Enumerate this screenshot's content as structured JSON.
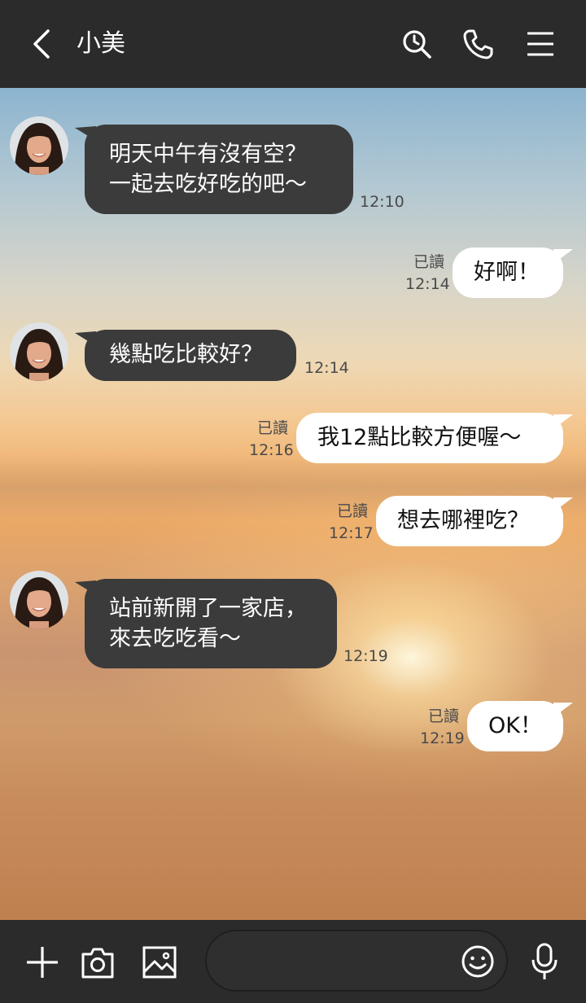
{
  "header": {
    "title": "小美",
    "back_icon": "chevron-left-icon",
    "search_icon": "search-icon",
    "call_icon": "phone-icon",
    "menu_icon": "menu-icon"
  },
  "messages": [
    {
      "side": "in",
      "text": "明天中午有沒有空？\n一起去吃好吃的吧～",
      "time": "12:10"
    },
    {
      "side": "out",
      "text": "好啊！",
      "read": "已讀",
      "time": "12:14"
    },
    {
      "side": "in",
      "text": "幾點吃比較好？",
      "time": "12:14"
    },
    {
      "side": "out",
      "text": "我12點比較方便喔～",
      "read": "已讀",
      "time": "12:16"
    },
    {
      "side": "out",
      "text": "想去哪裡吃？",
      "read": "已讀",
      "time": "12:17"
    },
    {
      "side": "in",
      "text": "站前新開了一家店，\n來去吃吃看～",
      "time": "12:19"
    },
    {
      "side": "out",
      "text": "OK！",
      "read": "已讀",
      "time": "12:19"
    }
  ],
  "input": {
    "value": "",
    "add_icon": "plus-icon",
    "camera_icon": "camera-icon",
    "image_icon": "image-icon",
    "emoji_icon": "emoji-icon",
    "mic_icon": "microphone-icon"
  },
  "colors": {
    "bar": "#2b2b2b",
    "incoming_bubble": "#3b3b3b",
    "outgoing_bubble": "#ffffff"
  }
}
